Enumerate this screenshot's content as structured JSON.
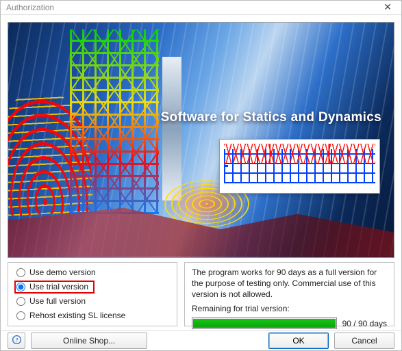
{
  "window": {
    "title": "Authorization"
  },
  "banner": {
    "slogan": "Software for Statics and Dynamics"
  },
  "options": {
    "demo": "Use demo version",
    "trial": "Use trial version",
    "full": "Use full version",
    "rehost": "Rehost existing SL license",
    "selected": "trial"
  },
  "info": {
    "description": "The program works for 90 days as a full version for the purpose of testing only. Commercial use of this version is not allowed.",
    "remaining_label": "Remaining for trial version:",
    "remaining_value": "90 / 90 days",
    "progress_pct": 100
  },
  "footer": {
    "shop": "Online Shop...",
    "ok": "OK",
    "cancel": "Cancel"
  }
}
